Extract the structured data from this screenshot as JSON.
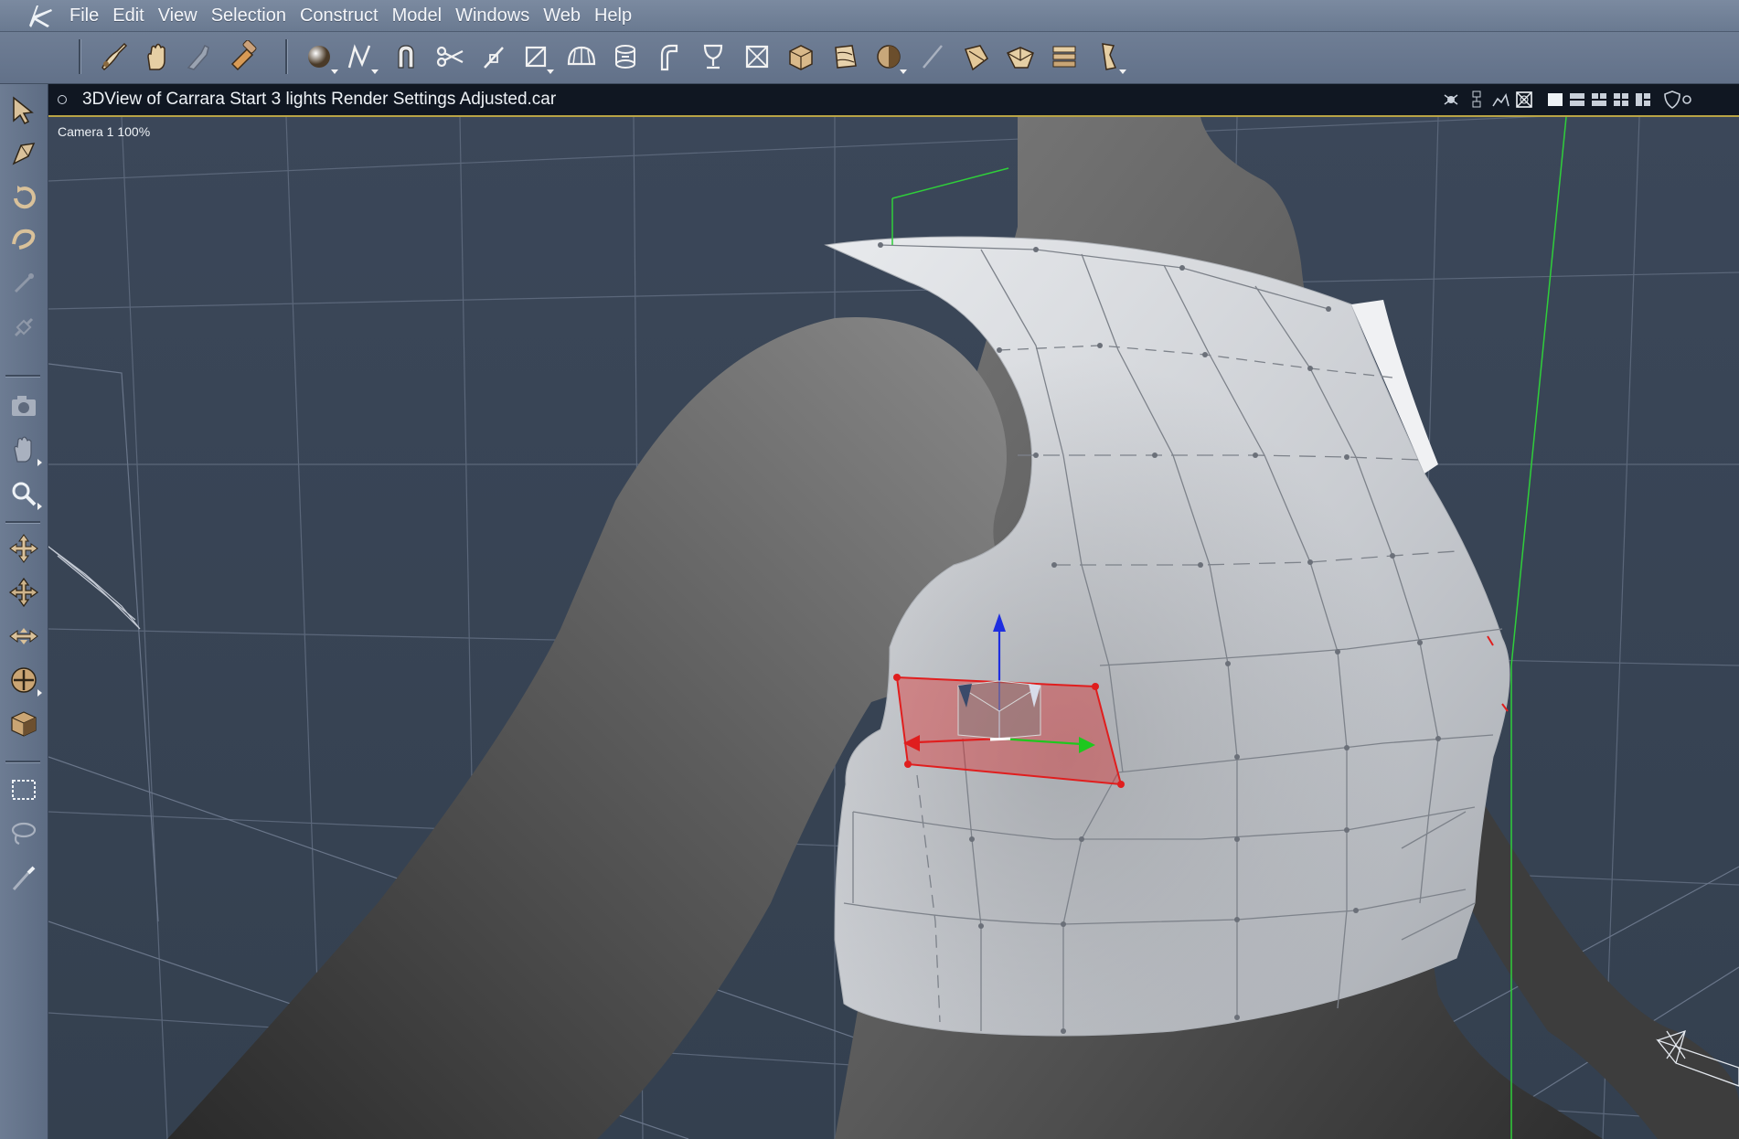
{
  "menu": {
    "items": [
      "File",
      "Edit",
      "View",
      "Selection",
      "Construct",
      "Model",
      "Windows",
      "Web",
      "Help"
    ]
  },
  "toolbar": {
    "icons": [
      "spline-brush-icon",
      "pan-hand-icon",
      "arm-grab-icon",
      "hammer-icon",
      "sphere-primitive-icon",
      "spline-curve-icon",
      "magnet-icon",
      "scissors-icon",
      "knife-icon",
      "bounding-box-icon",
      "half-dome-icon",
      "extrude-icon",
      "bend-icon",
      "goblet-icon",
      "crossed-box-icon",
      "textured-box-icon",
      "twist-box-icon",
      "sphere-shaded-icon",
      "needle-icon",
      "rope-deform-icon",
      "fold-box-icon",
      "stack-icon",
      "lathe-figure-icon"
    ]
  },
  "left_tools": {
    "icons": [
      "select-arrow-icon",
      "rotate-arrow-icon",
      "orbit-icon",
      "twist-icon",
      "pin-icon",
      "link-icon",
      "camera-icon",
      "hand-pan-icon",
      "zoom-icon",
      "move-icon",
      "move-all-icon",
      "move-plane-icon",
      "scale-icon",
      "box-shade-icon",
      "marquee-select-icon",
      "lasso-select-icon",
      "paint-brush-icon"
    ]
  },
  "view": {
    "title": "3DView of Carrara Start 3 lights Render Settings Adjusted.car",
    "camera_label": "Camera 1 100%",
    "layout_buttons": [
      "single-view-icon",
      "two-view-icon",
      "three-view-icon",
      "four-view-icon",
      "custom-view-icon"
    ]
  },
  "colors": {
    "viewport_bg": "#3a4659",
    "selection": "#e01e1e",
    "gizmo_x": "#e01e1e",
    "gizmo_y": "#1ec81e",
    "gizmo_z": "#1e2ee0",
    "header_accent": "#b9a445"
  }
}
